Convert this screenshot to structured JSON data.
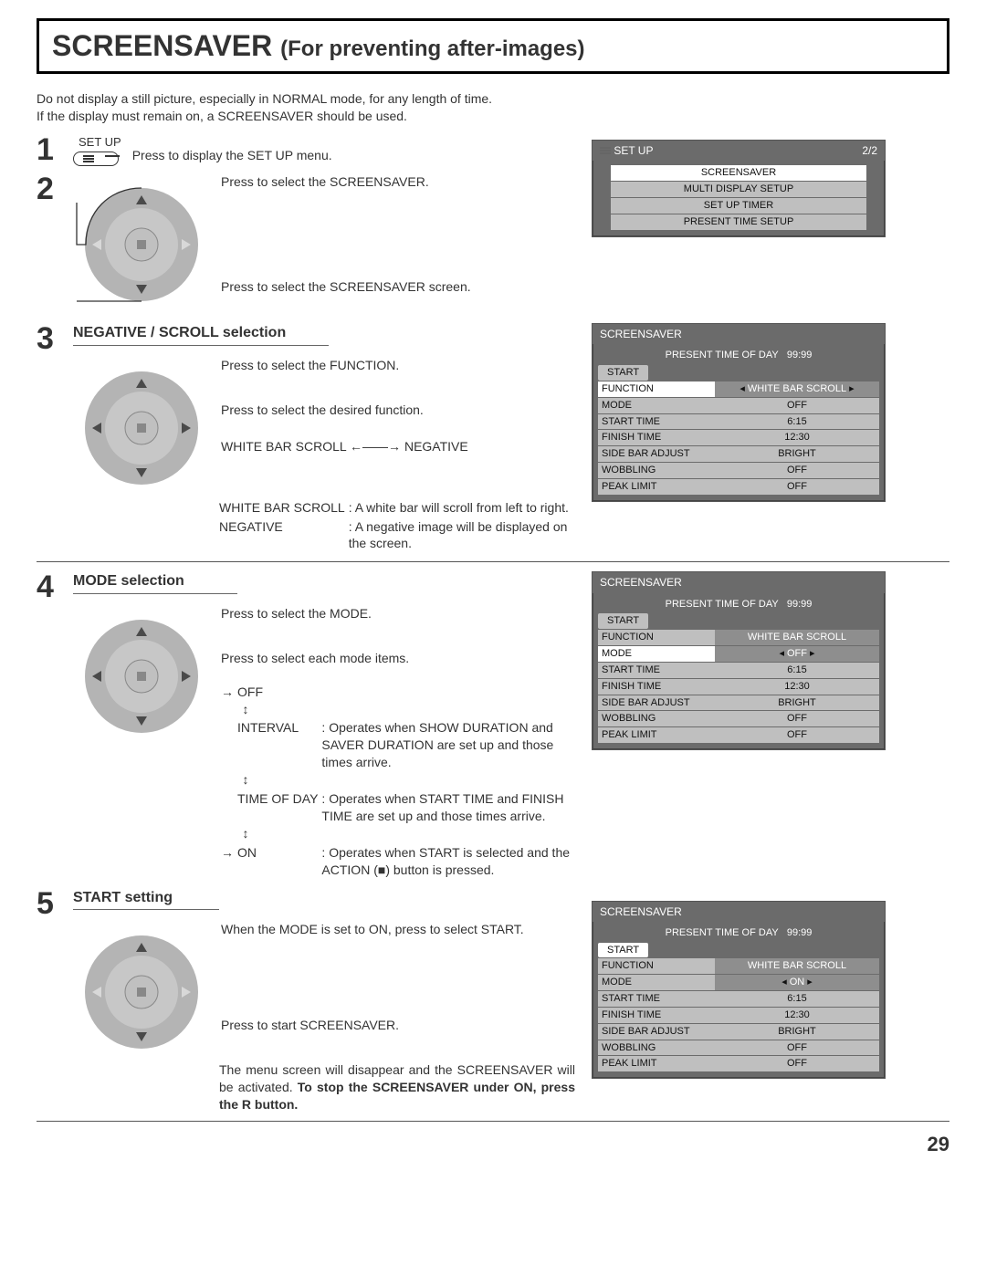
{
  "title_main": "SCREENSAVER",
  "title_sub": "For preventing after-images)",
  "intro_line1": "Do not display a still picture, especially in NORMAL mode, for any length of time.",
  "intro_line2": "If the display must remain on, a SCREENSAVER should be used.",
  "step1": {
    "num": "1",
    "button_label": "SET UP",
    "text": "Press to display the SET UP menu."
  },
  "step2": {
    "num": "2",
    "text_top": "Press to select the SCREENSAVER.",
    "text_bottom": "Press to select the SCREENSAVER screen."
  },
  "setup_menu": {
    "title": "SET UP",
    "page": "2/2",
    "items": [
      "SCREENSAVER",
      "MULTI DISPLAY SETUP",
      "SET UP TIMER",
      "PRESENT TIME SETUP"
    ]
  },
  "step3": {
    "num": "3",
    "heading": "NEGATIVE / SCROLL selection",
    "lineA": "Press to select the FUNCTION.",
    "lineB": "Press to select the desired function.",
    "toggle_left": "WHITE BAR SCROLL",
    "toggle_right": "NEGATIVE",
    "def1_k": "WHITE BAR SCROLL",
    "def1_v": ": A white bar will scroll from left to right.",
    "def2_k": "NEGATIVE",
    "def2_v": ": A negative image will be displayed on the screen."
  },
  "step4": {
    "num": "4",
    "heading": "MODE selection",
    "lineA": "Press to select the MODE.",
    "lineB": "Press to select each mode items.",
    "cyc1": "OFF",
    "cyc2": "INTERVAL",
    "cyc3": "TIME OF DAY",
    "cyc4": "ON",
    "def_interval": ": Operates when SHOW DURATION and SAVER DURATION are set up and those times arrive.",
    "def_tod": ": Operates when START TIME and FINISH TIME are set up and those times arrive.",
    "def_on_a": ": Operates when START is selected and the ACTION (",
    "def_on_b": ") button is pressed."
  },
  "step5": {
    "num": "5",
    "heading": "START setting",
    "lineA": "When the MODE is set to ON, press to select START.",
    "lineB": "Press to start SCREENSAVER.",
    "tail1": "The menu screen will disappear and the SCREENSAVER will be activated. ",
    "tail2": "To stop the SCREENSAVER under ON, press the R button."
  },
  "osd_common": {
    "title": "SCREENSAVER",
    "present_label": "PRESENT  TIME OF DAY",
    "present_val": "99:99",
    "start": "START",
    "k_function": "FUNCTION",
    "k_mode": "MODE",
    "k_start_time": "START TIME",
    "k_finish_time": "FINISH TIME",
    "k_sidebar": "SIDE BAR ADJUST",
    "k_wobbling": "WOBBLING",
    "k_peak": "PEAK LIMIT",
    "v_function": "WHITE BAR SCROLL",
    "v_start_time": "6:15",
    "v_finish_time": "12:30",
    "v_sidebar": "BRIGHT",
    "v_off": "OFF",
    "v_on": "ON"
  },
  "page_number": "29"
}
